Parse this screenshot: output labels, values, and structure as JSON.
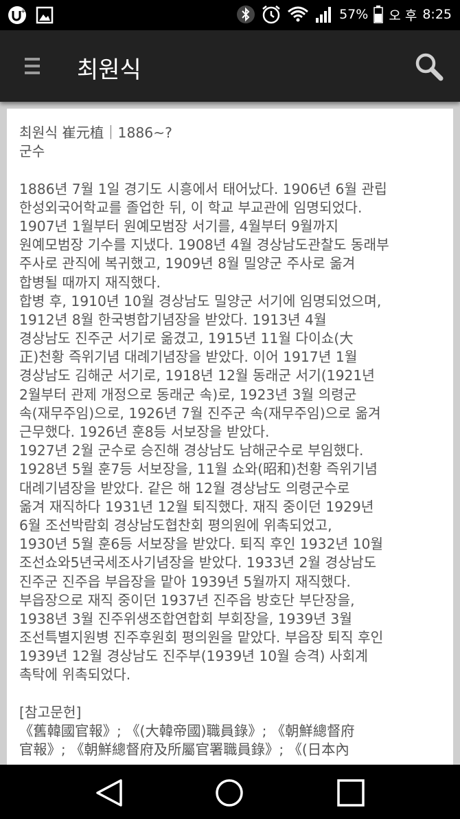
{
  "status_bar": {
    "battery_percent": "57%",
    "ampm": "오 후",
    "time": "8:25",
    "icons": [
      "u-plus-icon",
      "image-icon",
      "bluetooth-icon",
      "alarm-icon",
      "wifi-icon",
      "signal-icon",
      "battery-icon"
    ]
  },
  "app_bar": {
    "title": "최원식",
    "menu_icon": "menu-icon",
    "search_icon": "search-icon"
  },
  "article": {
    "lines": [
      "최원식 崔元植｜1886~?",
      "군수",
      "",
      "1886년 7월 1일 경기도 시흥에서 태어났다. 1906년 6월 관립",
      "한성외국어학교를 졸업한 뒤, 이 학교 부교관에 임명되었다.",
      "1907년 1월부터 원예모범장 서기를, 4월부터 9월까지",
      "원예모범장 기수를 지냈다. 1908년 4월 경상남도관찰도 동래부",
      "주사로 관직에 복귀했고, 1909년 8월 밀양군 주사로 옮겨",
      "합병될 때까지 재직했다.",
      "합병 후, 1910년 10월 경상남도 밀양군 서기에 임명되었으며,",
      "1912년 8월 한국병합기념장을 받았다. 1913년 4월",
      "경상남도 진주군 서기로 옮겼고, 1915년 11월 다이쇼(大",
      "正)천황 즉위기념 대례기념장을 받았다. 이어 1917년 1월",
      "경상남도 김해군 서기로, 1918년 12월 동래군 서기(1921년",
      "2월부터 관제 개정으로 동래군 속)로, 1923년 3월 의령군",
      "속(재무주임)으로, 1926년 7월 진주군 속(재무주임)으로 옮겨",
      "근무했다. 1926년 훈8등 서보장을 받았다.",
      "1927년 2월 군수로 승진해 경상남도 남해군수로 부임했다.",
      "1928년 5월 훈7등 서보장을, 11월 쇼와(昭和)천황 즉위기념",
      "대례기념장을 받았다. 같은 해 12월 경상남도 의령군수로",
      "옮겨 재직하다 1931년 12월 퇴직했다. 재직 중이던 1929년",
      "6월 조선박람회 경상남도협찬회 평의원에 위촉되었고,",
      "1930년 5월 훈6등 서보장을 받았다. 퇴직 후인 1932년 10월",
      "조선쇼와5년국세조사기념장을 받았다. 1933년 2월 경상남도",
      "진주군 진주읍 부읍장을 맡아 1939년 5월까지 재직했다.",
      "부읍장으로 재직 중이던 1937년 진주읍 방호단 부단장을,",
      "1938년 3월 진주위생조합연합회 부회장을, 1939년 3월",
      "조선특별지원병 진주후원회 평의원을 맡았다. 부읍장 퇴직 후인",
      "1939년 12월 경상남도 진주부(1939년 10월 승격) 사회계",
      "촉탁에 위촉되었다.",
      "",
      "[참고문헌]",
      "《舊韓國官報》; 《(大韓帝國)職員錄》; 《朝鮮總督府",
      "官報》; 《朝鮮總督府及所屬官署職員錄》; 《(日本內"
    ]
  },
  "nav_bar": {
    "icons": [
      "back-icon",
      "home-icon",
      "recent-apps-icon"
    ]
  }
}
